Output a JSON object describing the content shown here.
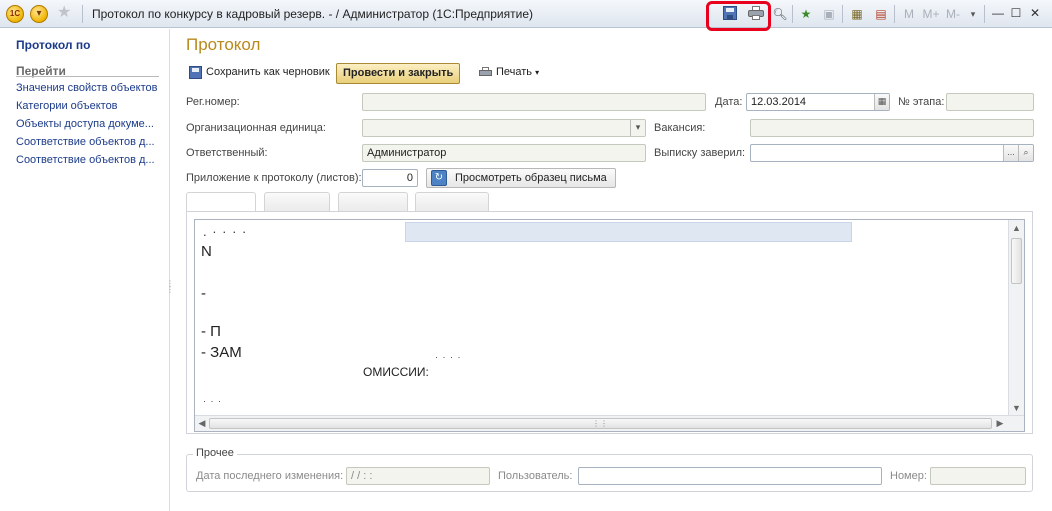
{
  "window": {
    "title": "Протокол по конкурсу в кадровый резерв. - / Администратор  (1С:Предприятие)",
    "logo_text": "1С",
    "toolbar_m_labels": [
      "M",
      "M+",
      "M-"
    ]
  },
  "left_panel": {
    "title": "Протокол по",
    "goto_label": "Перейти",
    "links": [
      "Значения свойств объектов",
      "Категории объектов",
      "Объекты доступа докуме...",
      "Соответствие объектов д...",
      "Соответствие объектов д..."
    ]
  },
  "form": {
    "title": "Протокол",
    "save_draft_label": "Сохранить как черновик",
    "post_close_label": "Провести и закрыть",
    "print_label": "Печать",
    "fields": {
      "reg_number_label": "Рег.номер:",
      "reg_number_value": "",
      "date_label": "Дата:",
      "date_value": "12.03.2014",
      "stage_label": "№ этапа:",
      "stage_value": "",
      "org_unit_label": "Организационная единица:",
      "org_unit_value": "",
      "vacancy_label": "Вакансия:",
      "vacancy_value": "",
      "responsible_label": "Ответственный:",
      "responsible_value": "Администратор",
      "certified_label": "Выписку заверил:",
      "certified_value": "",
      "attachment_label": "Приложение к протоколу (листов):",
      "attachment_value": "0",
      "preview_label": "Просмотреть образец письма"
    },
    "editor_lines": [
      "N",
      "-",
      "- П",
      "- ЗАМ",
      "ОМИССИИ:"
    ],
    "other_group": {
      "title": "Прочее",
      "last_change_label": "Дата последнего изменения:",
      "last_change_value": " / /    :  :",
      "user_label": "Пользователь:",
      "user_value": "",
      "number_label": "Номер:",
      "number_value": ""
    }
  }
}
